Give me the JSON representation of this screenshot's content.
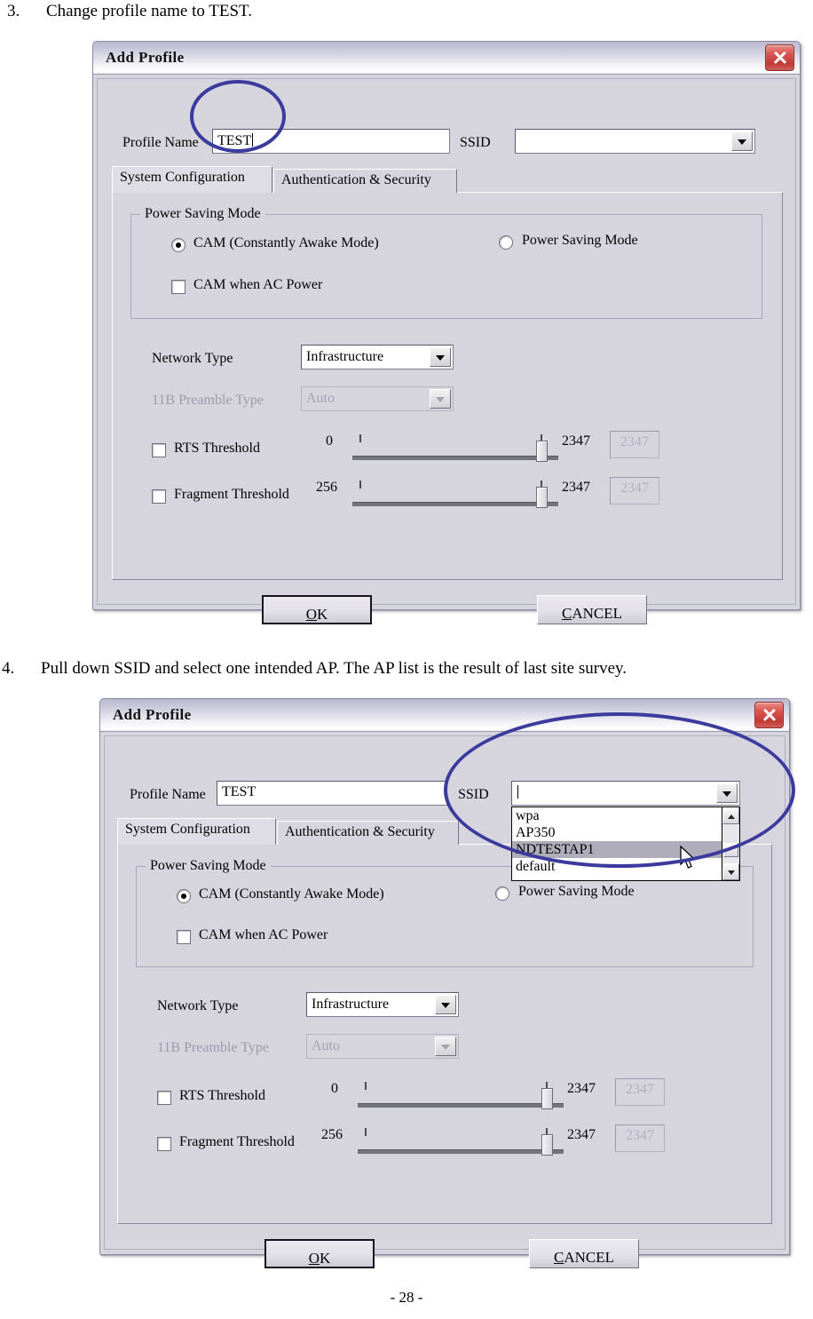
{
  "page": {
    "footer": "- 28 -"
  },
  "steps": [
    {
      "number": "3.",
      "text": "Change profile name to TEST."
    },
    {
      "number": "4.",
      "text": "Pull down SSID and select one intended AP. The AP list is the result of last site survey."
    }
  ],
  "dialog": {
    "title": "Add Profile",
    "close_icon": "close-icon",
    "profile_name_label": "Profile Name",
    "ssid_label": "SSID",
    "tabs": [
      {
        "label": "System Configuration",
        "active": true
      },
      {
        "label": "Authentication & Security",
        "active": false
      }
    ],
    "power_saving": {
      "group_title": "Power Saving Mode",
      "cam_label": "CAM (Constantly Awake Mode)",
      "psm_label": "Power Saving Mode",
      "cam_ac_label": "CAM when AC Power",
      "cam_checked": true,
      "psm_checked": false,
      "cam_ac_checked": false
    },
    "network_type_label": "Network Type",
    "network_type_value": "Infrastructure",
    "preamble_label": "11B Preamble Type",
    "preamble_value": "Auto",
    "rts": {
      "label": "RTS Threshold",
      "min": "0",
      "max": "2347",
      "readout": "2347",
      "checked": false
    },
    "fragment": {
      "label": "Fragment Threshold",
      "min": "256",
      "max": "2347",
      "readout": "2347",
      "checked": false
    },
    "buttons": {
      "ok": "OK",
      "ok_mnemonic": "O",
      "ok_rest": "K",
      "cancel": "CANCEL",
      "cancel_mnemonic": "C",
      "cancel_rest": "ANCEL"
    }
  },
  "figure_one": {
    "profile_name_value": "TEST",
    "ssid_value": "",
    "annotation": "highlight-profile-name-field"
  },
  "figure_two": {
    "profile_name_value": "TEST",
    "ssid_value": "",
    "annotation": "highlight-ssid-dropdown",
    "dropdown": {
      "open": true,
      "items": [
        {
          "label": "wpa",
          "selected": false
        },
        {
          "label": "AP350",
          "selected": false
        },
        {
          "label": "NDTESTAP1",
          "selected": true
        },
        {
          "label": "default",
          "selected": false
        }
      ],
      "scroll_up_icon": "chevron-up-icon",
      "scroll_down_icon": "chevron-down-icon"
    },
    "cursor_icon": "mouse-pointer-icon"
  },
  "colors": {
    "annotation_blue": "#3b3b9e",
    "close_red": "#cc3b36",
    "dialog_face": "#d6d5de",
    "selection_gray": "#aeadb9"
  }
}
